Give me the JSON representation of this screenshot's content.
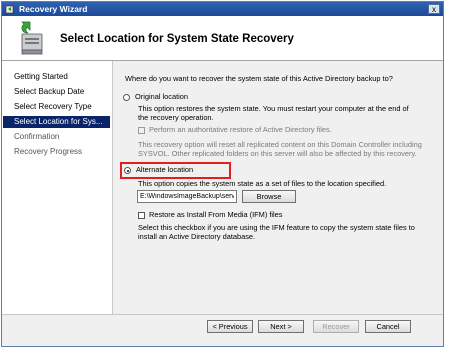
{
  "window": {
    "title": "Recovery Wizard",
    "close_glyph": "x"
  },
  "header": {
    "title": "Select Location for System State Recovery",
    "icon": "server-restore-icon"
  },
  "sidebar": {
    "items": [
      {
        "label": "Getting Started"
      },
      {
        "label": "Select Backup Date"
      },
      {
        "label": "Select Recovery Type"
      },
      {
        "label": "Select Location for Sys..."
      },
      {
        "label": "Confirmation"
      },
      {
        "label": "Recovery Progress"
      }
    ],
    "active_index": 3
  },
  "main": {
    "question": "Where do you want to recover the system state of this Active Directory backup to?",
    "original": {
      "label": "Original location",
      "desc1": "This option restores the system state. You must restart your computer at the end of",
      "desc2": "the recovery operation.",
      "checkbox_label": "Perform an authoritative restore of Active Directory files.",
      "note1": "This recovery option will reset all replicated content on this Domain Controller including",
      "note2": "SYSVOL. Other replicated folders on this server will also be affected by this recovery."
    },
    "alternate": {
      "label": "Alternate location",
      "desc": "This option copies the system state as a set of files to the location specified.",
      "path_value": "E:\\WindowsImageBackup\\server1\\",
      "browse_label": "Browse",
      "ifm_label": "Restore as Install From Media (IFM) files",
      "ifm_desc1": "Select this checkbox if you are using the IFM feature to copy the system state files to",
      "ifm_desc2": "install an Active Directory database."
    },
    "selected_option": "alternate"
  },
  "footer": {
    "previous_label": "< Previous",
    "next_label": "Next >",
    "recover_label": "Recover",
    "cancel_label": "Cancel"
  },
  "colors": {
    "title_bar": "#1c4a97",
    "active_nav": "#0a246a",
    "highlight": "#e02020"
  }
}
